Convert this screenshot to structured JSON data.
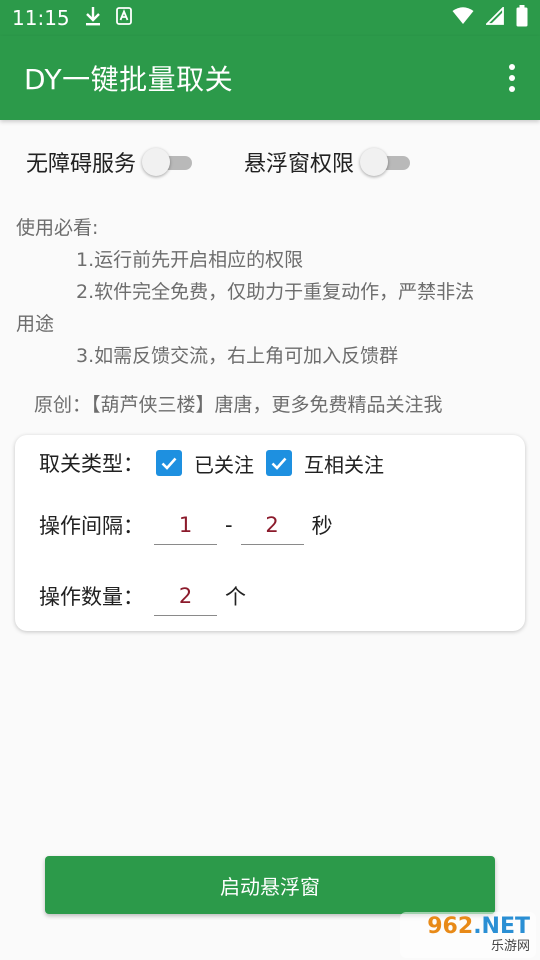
{
  "status_bar": {
    "time": "11:15",
    "download_icon": "download-icon",
    "notification_icon": "a-notification-icon",
    "wifi_icon": "wifi-icon",
    "signal_icon": "signal-icon",
    "battery_icon": "battery-icon"
  },
  "app_bar": {
    "title": "DY一键批量取关",
    "overflow_icon": "overflow-menu-icon"
  },
  "permissions": {
    "accessibility_label": "无障碍服务",
    "accessibility_on": false,
    "overlay_label": "悬浮窗权限",
    "overlay_on": false
  },
  "instructions": {
    "heading": "使用必看:",
    "item1": "1.运行前先开启相应的权限",
    "item2_a": "2.软件完全免费，仅助力于重复动作，严禁非法",
    "item2_b": "用途",
    "item3": "3.如需反馈交流，右上角可加入反馈群"
  },
  "credit": "原创：【葫芦侠三楼】唐唐，更多免费精品关注我",
  "settings": {
    "type_label": "取关类型：",
    "followed_label": "已关注",
    "followed_checked": true,
    "mutual_label": "互相关注",
    "mutual_checked": true,
    "interval_label": "操作间隔：",
    "interval_min": "1",
    "interval_sep": "-",
    "interval_max": "2",
    "interval_unit": "秒",
    "count_label": "操作数量：",
    "count_value": "2",
    "count_unit": "个"
  },
  "start_button": "启动悬浮窗",
  "watermark": {
    "top_orange": "962",
    "top_blue": ".NET",
    "bottom": "乐游网"
  },
  "colors": {
    "primary": "#2c9a4a",
    "checkbox": "#1e90e0",
    "input_text": "#8b1a2b"
  }
}
